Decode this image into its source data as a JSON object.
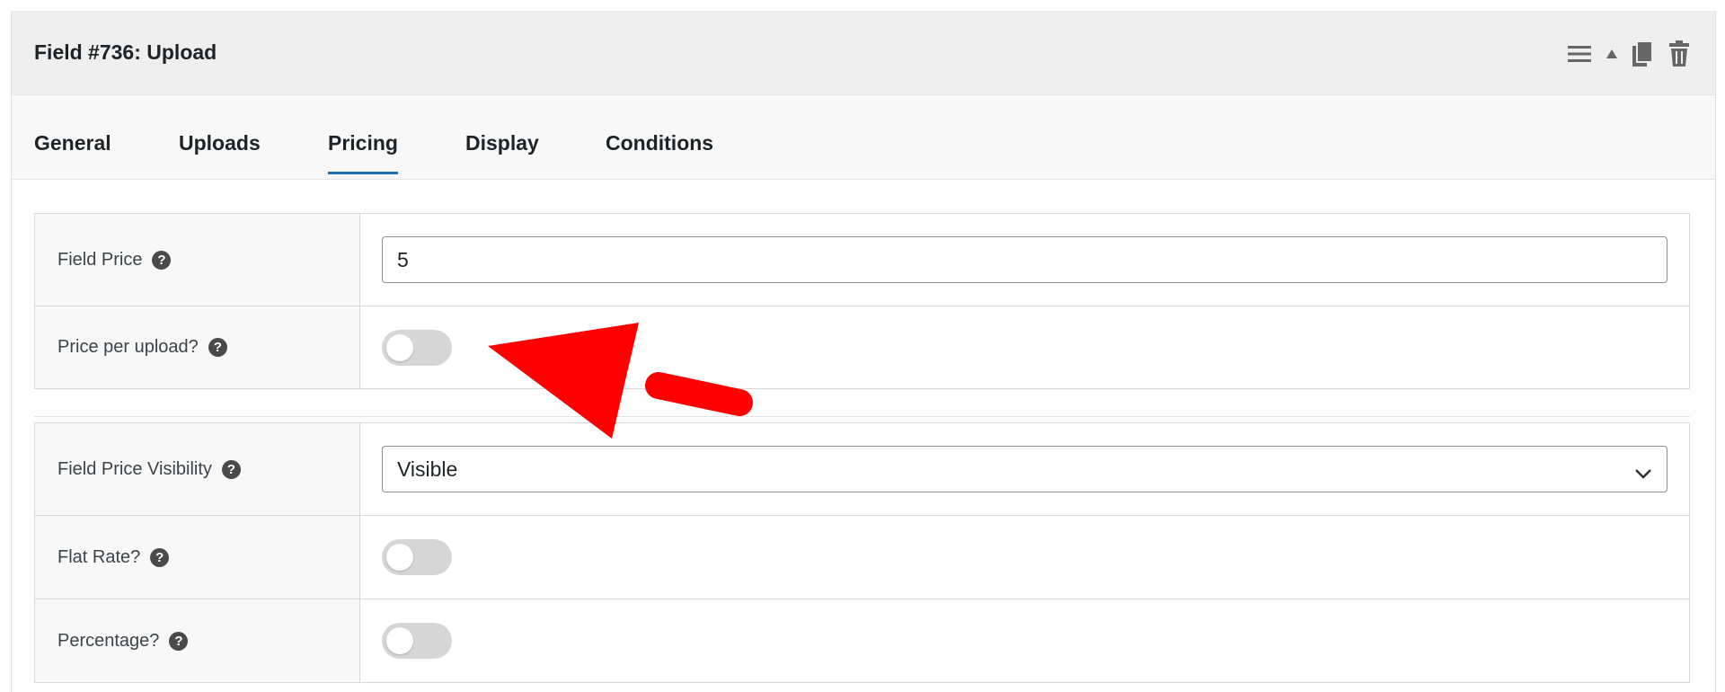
{
  "header": {
    "title": "Field #736: Upload",
    "actions": [
      {
        "icon": "menu-lines-icon"
      },
      {
        "icon": "collapse-arrow-icon"
      },
      {
        "icon": "copy-icon"
      },
      {
        "icon": "trash-icon"
      }
    ]
  },
  "tabs": [
    {
      "label": "General",
      "active": false
    },
    {
      "label": "Uploads",
      "active": false
    },
    {
      "label": "Pricing",
      "active": true
    },
    {
      "label": "Display",
      "active": false
    },
    {
      "label": "Conditions",
      "active": false
    }
  ],
  "pricing": {
    "field_price": {
      "label": "Field Price",
      "value": "5"
    },
    "price_per_upload": {
      "label": "Price per upload?",
      "enabled": false
    }
  },
  "display": {
    "field_price_visibility": {
      "label": "Field Price Visibility",
      "selected": "Visible"
    },
    "flat_rate": {
      "label": "Flat Rate?",
      "enabled": false
    },
    "percentage": {
      "label": "Percentage?",
      "enabled": false
    }
  },
  "help_icon": {
    "glyph": "?"
  },
  "colors": {
    "accent": "#2271b1",
    "annotation_arrow": "#ff0000",
    "toggle_off": "#d6d6d6"
  }
}
